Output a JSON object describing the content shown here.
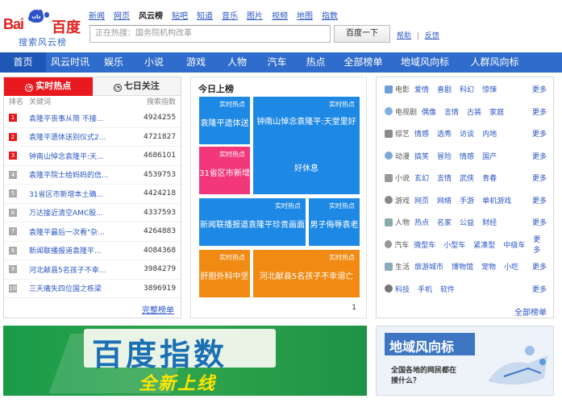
{
  "logo": {
    "bai": "Bai",
    "du": "du",
    "cn": "百度",
    "sub": "搜索风云榜"
  },
  "topnav": [
    "新闻",
    "网页",
    "风云榜",
    "贴吧",
    "知道",
    "音乐",
    "图片",
    "视频",
    "地图",
    "指数"
  ],
  "topnav_current": "风云榜",
  "search": {
    "placeholder": "正在热搜：国务院机构改革",
    "button": "百度一下",
    "help": "帮助",
    "sep": "|",
    "feedback": "反馈"
  },
  "mainnav": [
    "首页",
    "风云时讯",
    "娱乐",
    "小说",
    "游戏",
    "人物",
    "汽车",
    "热点",
    "全部榜单",
    "地域风向标",
    "人群风向标"
  ],
  "left": {
    "tab_on": "实时热点",
    "tab_off": "七日关注",
    "headers": {
      "rank": "排名",
      "keyword": "关键词",
      "index": "搜索指数"
    },
    "rows": [
      {
        "r": "1",
        "k": "袁隆平丧事从简 不接...",
        "v": "4924255"
      },
      {
        "r": "2",
        "k": "袁隆平遗体送别仪式2...",
        "v": "4721827"
      },
      {
        "r": "3",
        "k": "钟南山悼念袁隆平:天...",
        "v": "4686101"
      },
      {
        "r": "4",
        "k": "袁隆平院士给妈妈的信...",
        "v": "4539753"
      },
      {
        "r": "5",
        "k": "31省区市新增本土确...",
        "v": "4424218"
      },
      {
        "r": "6",
        "k": "万达接近清空AMC股...",
        "v": "4337593"
      },
      {
        "r": "7",
        "k": "袁隆平最后一次看\"杂...",
        "v": "4264883"
      },
      {
        "r": "8",
        "k": "新闻联播报道袁隆平...",
        "v": "4084368"
      },
      {
        "r": "9",
        "k": "河北献县5名孩子不幸...",
        "v": "3984279"
      },
      {
        "r": "10",
        "k": "三天痛失四位国之栋梁",
        "v": "3896919"
      }
    ],
    "more": "完整榜单"
  },
  "mid": {
    "title": "今日上榜",
    "tag": "实时热点",
    "tiles": [
      {
        "text": "袁隆平遗体送"
      },
      {
        "text": "钟南山悼念袁隆平:天堂里好"
      },
      {
        "text": "31省区市新增"
      },
      {
        "text": "好休息"
      },
      {
        "text": "新闻联播报道袁隆平珍贵画面"
      },
      {
        "text": "男子侮辱袁老"
      },
      {
        "text": "肝胆外科中坚"
      },
      {
        "text": "河北献县5名孩子不幸溺亡"
      }
    ],
    "page": "1"
  },
  "right": {
    "cats": [
      {
        "icon": "movie-icon",
        "name": "电影",
        "words": [
          "爱情",
          "喜剧",
          "科幻",
          "惊悚"
        ]
      },
      {
        "icon": "tv-icon",
        "name": "电视剧",
        "words": [
          "偶像",
          "言情",
          "古装",
          "家庭"
        ]
      },
      {
        "icon": "variety-icon",
        "name": "综艺",
        "words": [
          "情感",
          "选秀",
          "访谈",
          "内地"
        ]
      },
      {
        "icon": "anime-icon",
        "name": "动漫",
        "words": [
          "搞笑",
          "冒险",
          "情感",
          "国产"
        ]
      },
      {
        "icon": "novel-icon",
        "name": "小说",
        "words": [
          "玄幻",
          "言情",
          "武侠",
          "青春"
        ]
      },
      {
        "icon": "game-icon",
        "name": "游戏",
        "words": [
          "网页",
          "网络",
          "手游",
          "单机游戏"
        ]
      },
      {
        "icon": "person-icon",
        "name": "人物",
        "words": [
          "热点",
          "名家",
          "公益",
          "财经"
        ]
      },
      {
        "icon": "car-icon",
        "name": "汽车",
        "words": [
          "微型车",
          "小型车",
          "紧凑型",
          "中级车"
        ]
      },
      {
        "icon": "life-icon",
        "name": "生活",
        "words": [
          "旅游城市",
          "博物馆",
          "宠物",
          "小吃"
        ]
      },
      {
        "icon": "tech-icon",
        "name": "",
        "words": [
          "科技",
          "手机",
          "软件"
        ]
      }
    ],
    "more": "更多",
    "all": "全部榜单"
  },
  "banner1": {
    "title": "百度指数",
    "sub": "全新上线"
  },
  "banner2": {
    "title": "地域风向标",
    "q1": "全国各地的网民都在",
    "q2": "搜什么？"
  },
  "colors": {
    "nav": "#2f6ccb",
    "red": "#e8191e",
    "link": "#2a56c5",
    "tile_blue": "#1e88e5",
    "tile_pink": "#f2387a",
    "tile_orange": "#f08a12"
  }
}
